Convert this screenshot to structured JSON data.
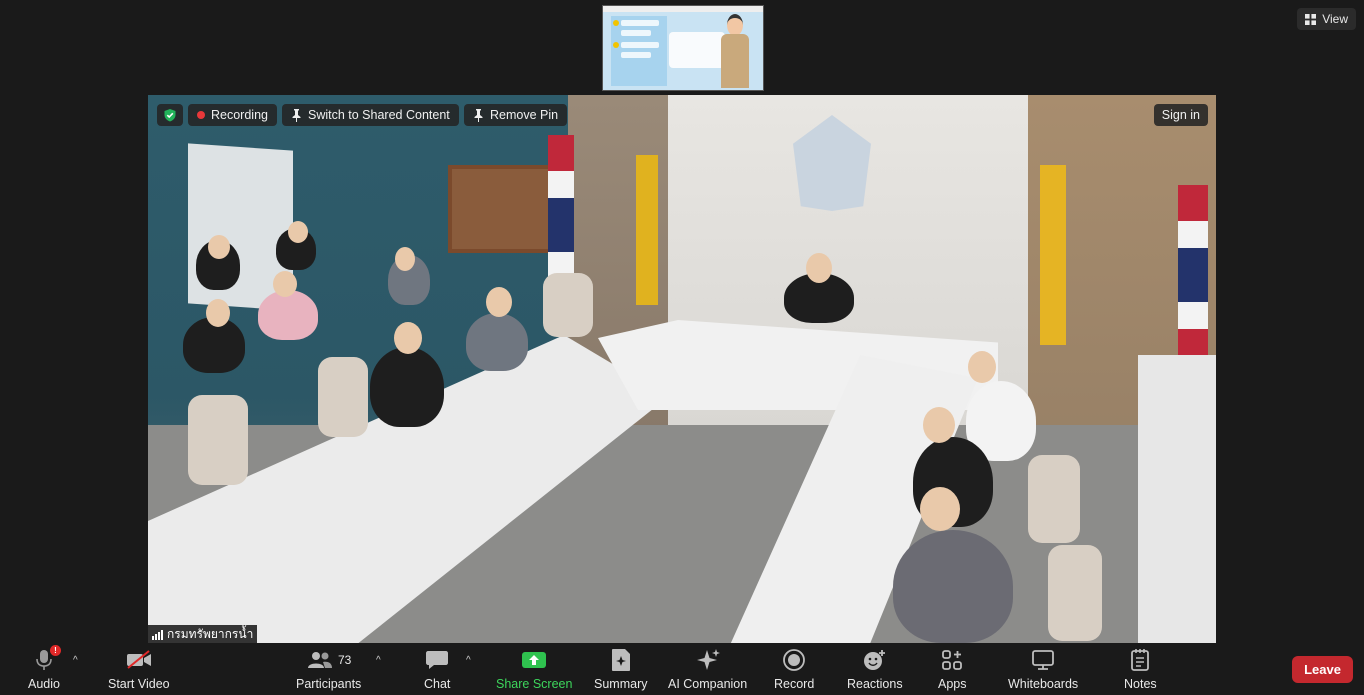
{
  "top_bar": {
    "view_label": "View"
  },
  "video": {
    "overlay": {
      "recording_label": "Recording",
      "switch_label": "Switch to Shared Content",
      "remove_pin_label": "Remove Pin",
      "sign_in_label": "Sign in"
    },
    "participant_name": "กรมทรัพยากรน้ำ"
  },
  "toolbar": {
    "audio_label": "Audio",
    "audio_badge": "!",
    "video_label": "Start Video",
    "participants_label": "Participants",
    "participants_count": "73",
    "chat_label": "Chat",
    "share_label": "Share Screen",
    "summary_label": "Summary",
    "ai_label": "AI Companion",
    "record_label": "Record",
    "reactions_label": "Reactions",
    "apps_label": "Apps",
    "whiteboards_label": "Whiteboards",
    "notes_label": "Notes",
    "leave_label": "Leave"
  },
  "colors": {
    "background": "#1a1a1a",
    "share_green": "#3dd65c",
    "leave_red": "#c4282e",
    "recording_red": "#e8383a",
    "shield_green": "#22b35a"
  }
}
